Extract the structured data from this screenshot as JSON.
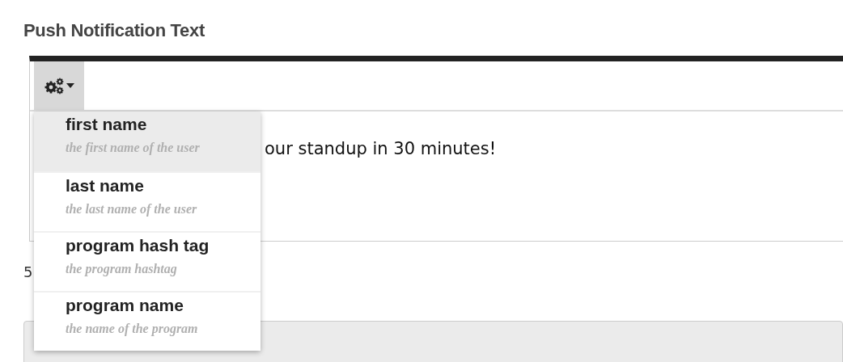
{
  "heading": "Push Notification Text",
  "editor": {
    "content": "our standup in 30 minutes!",
    "menu_open": true
  },
  "menu": [
    {
      "name": "first name",
      "description": "the first name of the user",
      "selected": true
    },
    {
      "name": "last name",
      "description": "the last name of the user",
      "selected": false
    },
    {
      "name": "program hash tag",
      "description": "the program hashtag",
      "selected": false
    },
    {
      "name": "program name",
      "description": "the name of the program",
      "selected": false
    }
  ],
  "counter": "5"
}
